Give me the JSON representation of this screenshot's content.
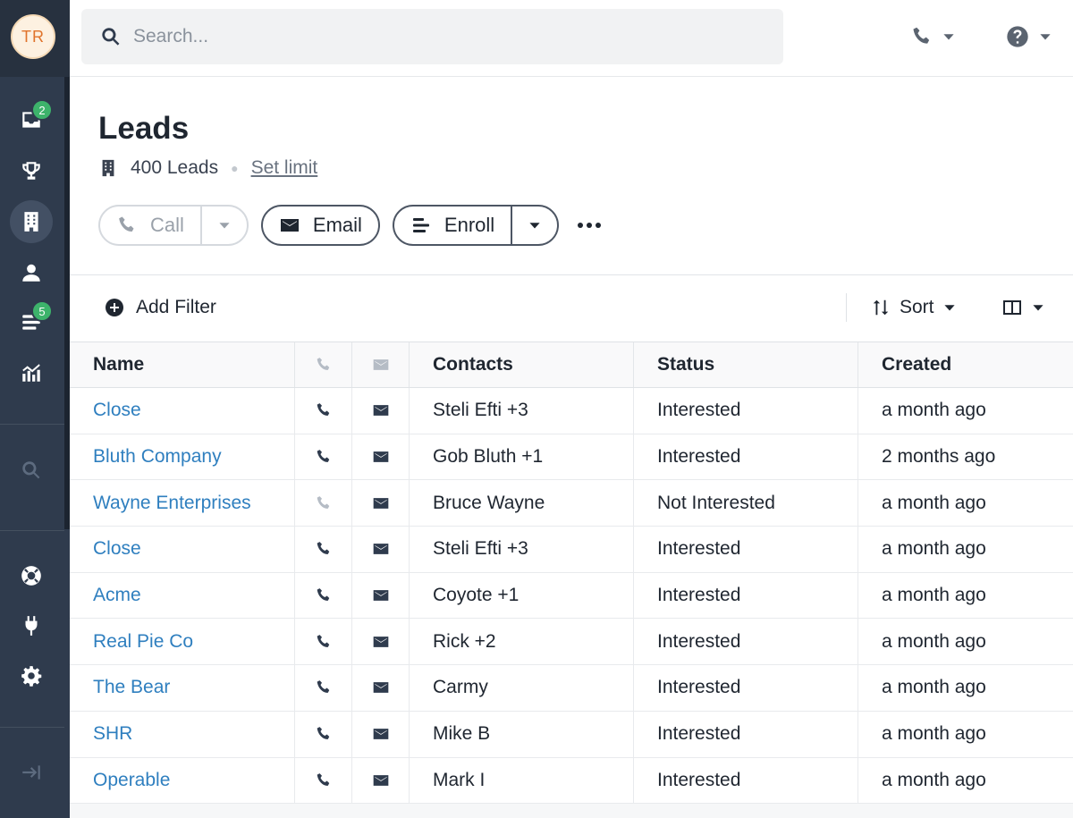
{
  "user": {
    "initials": "TR"
  },
  "sidebar": {
    "inbox_badge": "2",
    "sequences_badge": "5"
  },
  "search": {
    "placeholder": "Search..."
  },
  "page": {
    "title": "Leads",
    "count_label": "400 Leads",
    "set_limit": "Set limit"
  },
  "actions": {
    "call": "Call",
    "email": "Email",
    "enroll": "Enroll"
  },
  "filters": {
    "add_filter": "Add Filter",
    "sort": "Sort"
  },
  "table": {
    "headers": {
      "name": "Name",
      "contacts": "Contacts",
      "status": "Status",
      "created": "Created"
    },
    "rows": [
      {
        "name": "Close",
        "contacts": "Steli Efti +3",
        "status": "Interested",
        "created": "a month ago",
        "has_phone": true
      },
      {
        "name": "Bluth Company",
        "contacts": "Gob Bluth +1",
        "status": "Interested",
        "created": "2 months ago",
        "has_phone": true
      },
      {
        "name": "Wayne Enterprises",
        "contacts": "Bruce Wayne",
        "status": "Not Interested",
        "created": "a month ago",
        "has_phone": false
      },
      {
        "name": "Close",
        "contacts": "Steli Efti +3",
        "status": "Interested",
        "created": "a month ago",
        "has_phone": true
      },
      {
        "name": "Acme",
        "contacts": "Coyote +1",
        "status": "Interested",
        "created": "a month ago",
        "has_phone": true
      },
      {
        "name": "Real Pie Co",
        "contacts": "Rick +2",
        "status": "Interested",
        "created": "a month ago",
        "has_phone": true
      },
      {
        "name": "The Bear",
        "contacts": "Carmy",
        "status": "Interested",
        "created": "a month ago",
        "has_phone": true
      },
      {
        "name": "SHR",
        "contacts": "Mike B",
        "status": "Interested",
        "created": "a month ago",
        "has_phone": true
      },
      {
        "name": "Operable",
        "contacts": "Mark I",
        "status": "Interested",
        "created": "a month ago",
        "has_phone": true
      }
    ]
  },
  "colors": {
    "link": "#2f7fbf",
    "sidebar": "#2f3b4d",
    "badge": "#3db36b",
    "avatar_text": "#e0732b"
  }
}
